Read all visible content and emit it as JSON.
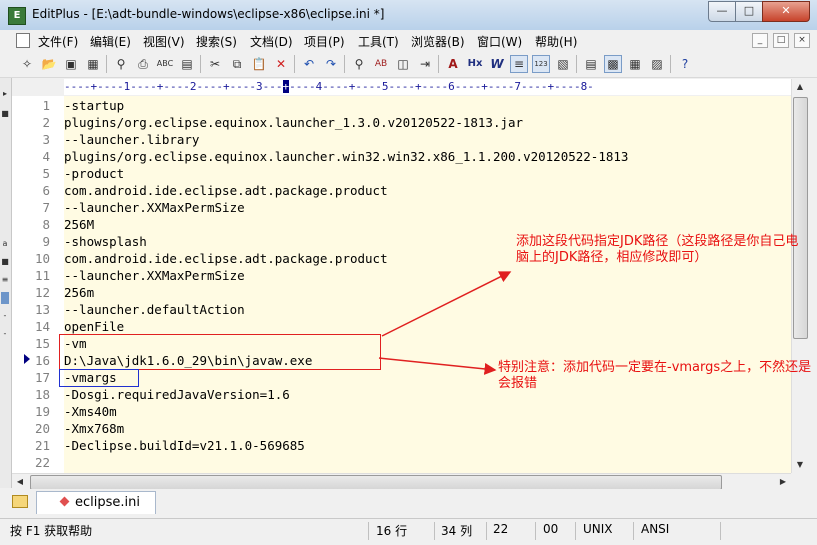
{
  "window": {
    "title": "EditPlus - [E:\\adt-bundle-windows\\eclipse-x86\\eclipse.ini *]",
    "min_icon": "minimize-icon",
    "max_icon": "maximize-icon",
    "close_icon": "close-icon"
  },
  "menu": {
    "items": [
      "文件(F)",
      "编辑(E)",
      "视图(V)",
      "搜索(S)",
      "文档(D)",
      "项目(P)",
      "工具(T)",
      "浏览器(B)",
      "窗口(W)",
      "帮助(H)"
    ],
    "mdi_buttons": [
      "_",
      "□",
      "×"
    ]
  },
  "toolbar": {
    "icons": [
      "new-file-icon",
      "open-icon",
      "save-icon",
      "save-all-icon",
      "print-preview-icon",
      "print-icon",
      "spell-check-icon",
      "properties-icon",
      "cut-icon",
      "copy-icon",
      "paste-icon",
      "delete-icon",
      "undo-icon",
      "redo-icon",
      "find-icon",
      "replace-icon",
      "find-in-files-icon",
      "goto-icon",
      "font-icon",
      "hex-view-icon",
      "word-wrap-icon",
      "line-number-toggle-icon",
      "column-ruler-icon",
      "cliptext-icon",
      "directory-panel-icon",
      "output-window-icon",
      "user-tool-icon",
      "help-icon"
    ]
  },
  "ruler": {
    "text": "----+----1----+----2----+----3---",
    "cursor": "+",
    "text_after": "----4----+----5----+----6----+----7----+----8-"
  },
  "editor": {
    "current_line": 16,
    "lines": [
      {
        "n": "1",
        "text": "-startup"
      },
      {
        "n": "2",
        "text": "plugins/org.eclipse.equinox.launcher_1.3.0.v20120522-1813.jar"
      },
      {
        "n": "3",
        "text": "--launcher.library"
      },
      {
        "n": "4",
        "text": "plugins/org.eclipse.equinox.launcher.win32.win32.x86_1.1.200.v20120522-1813"
      },
      {
        "n": "5",
        "text": "-product"
      },
      {
        "n": "6",
        "text": "com.android.ide.eclipse.adt.package.product"
      },
      {
        "n": "7",
        "text": "--launcher.XXMaxPermSize"
      },
      {
        "n": "8",
        "text": "256M"
      },
      {
        "n": "9",
        "text": "-showsplash"
      },
      {
        "n": "10",
        "text": "com.android.ide.eclipse.adt.package.product"
      },
      {
        "n": "11",
        "text": "--launcher.XXMaxPermSize"
      },
      {
        "n": "12",
        "text": "256m"
      },
      {
        "n": "13",
        "text": "--launcher.defaultAction"
      },
      {
        "n": "14",
        "text": "openFile"
      },
      {
        "n": "15",
        "text": "-vm"
      },
      {
        "n": "16",
        "text": "D:\\Java\\jdk1.6.0_29\\bin\\javaw.exe"
      },
      {
        "n": "17",
        "text": "-vmargs"
      },
      {
        "n": "18",
        "text": "-Dosgi.requiredJavaVersion=1.6"
      },
      {
        "n": "19",
        "text": "-Xms40m"
      },
      {
        "n": "20",
        "text": "-Xmx768m"
      },
      {
        "n": "21",
        "text": "-Declipse.buildId=v21.1.0-569685"
      },
      {
        "n": "22",
        "text": ""
      }
    ]
  },
  "annotations": {
    "note1": "添加这段代码指定JDK路径（这段路径是你自己电脑上的JDK路径，相应修改即可）",
    "note2": "特别注意：添加代码一定要在-vmargs之上，不然还是会报错",
    "color": "#e81010",
    "box_color": "#e02020",
    "vmargs_box_color": "#2030d0"
  },
  "tabs": [
    {
      "label": "eclipse.ini",
      "active": true
    }
  ],
  "status": {
    "help": "按 F1 获取帮助",
    "line": "16 行",
    "col": "34 列",
    "lines_total": "22",
    "code": "00",
    "eol": "UNIX",
    "encoding": "ANSI"
  }
}
